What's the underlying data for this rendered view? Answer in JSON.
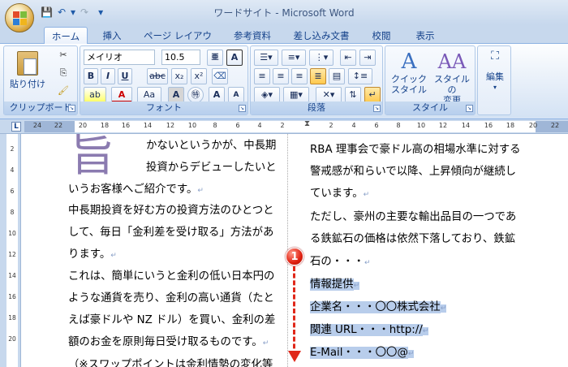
{
  "window": {
    "title": "ワードサイト - Microsoft Word"
  },
  "quick_access": {
    "save": "💾",
    "undo": "↶",
    "undo_drop": "▾",
    "redo": "↷",
    "custom": "▾"
  },
  "tabs": [
    "ホーム",
    "挿入",
    "ページ レイアウト",
    "参考資料",
    "差し込み文書",
    "校閲",
    "表示"
  ],
  "clipboard": {
    "paste_label": "貼り付け",
    "group_label": "クリップボード"
  },
  "font": {
    "name": "メイリオ",
    "size": "10.5",
    "bold": "B",
    "italic": "I",
    "underline": "U",
    "strike": "abc",
    "subscript": "x₂",
    "superscript": "x²",
    "clear": "A",
    "highlight": "ab",
    "color": "A",
    "case": "Aa",
    "grow": "A",
    "shrink": "A",
    "group_label": "フォント"
  },
  "paragraph": {
    "group_label": "段落"
  },
  "styles": {
    "quick_label": "クイック\nスタイル",
    "quick_label_1": "クイック",
    "quick_label_2": "スタイル",
    "change_label_1": "スタイルの",
    "change_label_2": "変更",
    "group_label": "スタイル"
  },
  "editing": {
    "label": "編集"
  },
  "ruler": {
    "corner": "L",
    "numbers": [
      "24",
      "22",
      "20",
      "18",
      "16",
      "14",
      "12",
      "10",
      "8",
      "6",
      "4",
      "2",
      "2",
      "4",
      "6",
      "8",
      "10",
      "12",
      "14",
      "16",
      "18",
      "20",
      "22",
      "24"
    ]
  },
  "vruler": {
    "numbers": [
      "2",
      "4",
      "6",
      "8",
      "10",
      "12",
      "14",
      "16",
      "18",
      "20"
    ]
  },
  "document": {
    "dropcap": "旨",
    "left": [
      "かないというかが、中長期",
      "投資からデビューしたいと",
      "いうお客様へご紹介です。",
      "中長期投資を好む方の投資方法のひとつと",
      "して、毎日「金利差を受け取る」方法があ",
      "ります。",
      "これは、簡単にいうと金利の低い日本円の",
      "ような通貨を売り、金利の高い通貨（たと",
      "えば豪ドルや NZ ドル）を買い、金利の差",
      "額のお金を原則毎日受け取るものです。",
      "（※スワップポイントは金利情勢の変化等"
    ],
    "right": [
      "RBA 理事会で豪ドル高の相場水準に対する",
      "警戒感が和らいで以降、上昇傾向が継続し",
      "ています。",
      "ただし、豪州の主要な輸出品目の一つであ",
      "る鉄鉱石の価格は依然下落しており、鉄鉱",
      "石の・・・",
      "情報提供",
      "企業名・・・〇〇株式会社",
      "関連 URL・・・http://",
      "E-Mail・・・〇〇@"
    ],
    "para_mark": "↵"
  },
  "callout": {
    "number": "1"
  },
  "colors": {
    "accent": "#15428b",
    "selection": "#b8cdeb",
    "callout": "#e0281a"
  }
}
